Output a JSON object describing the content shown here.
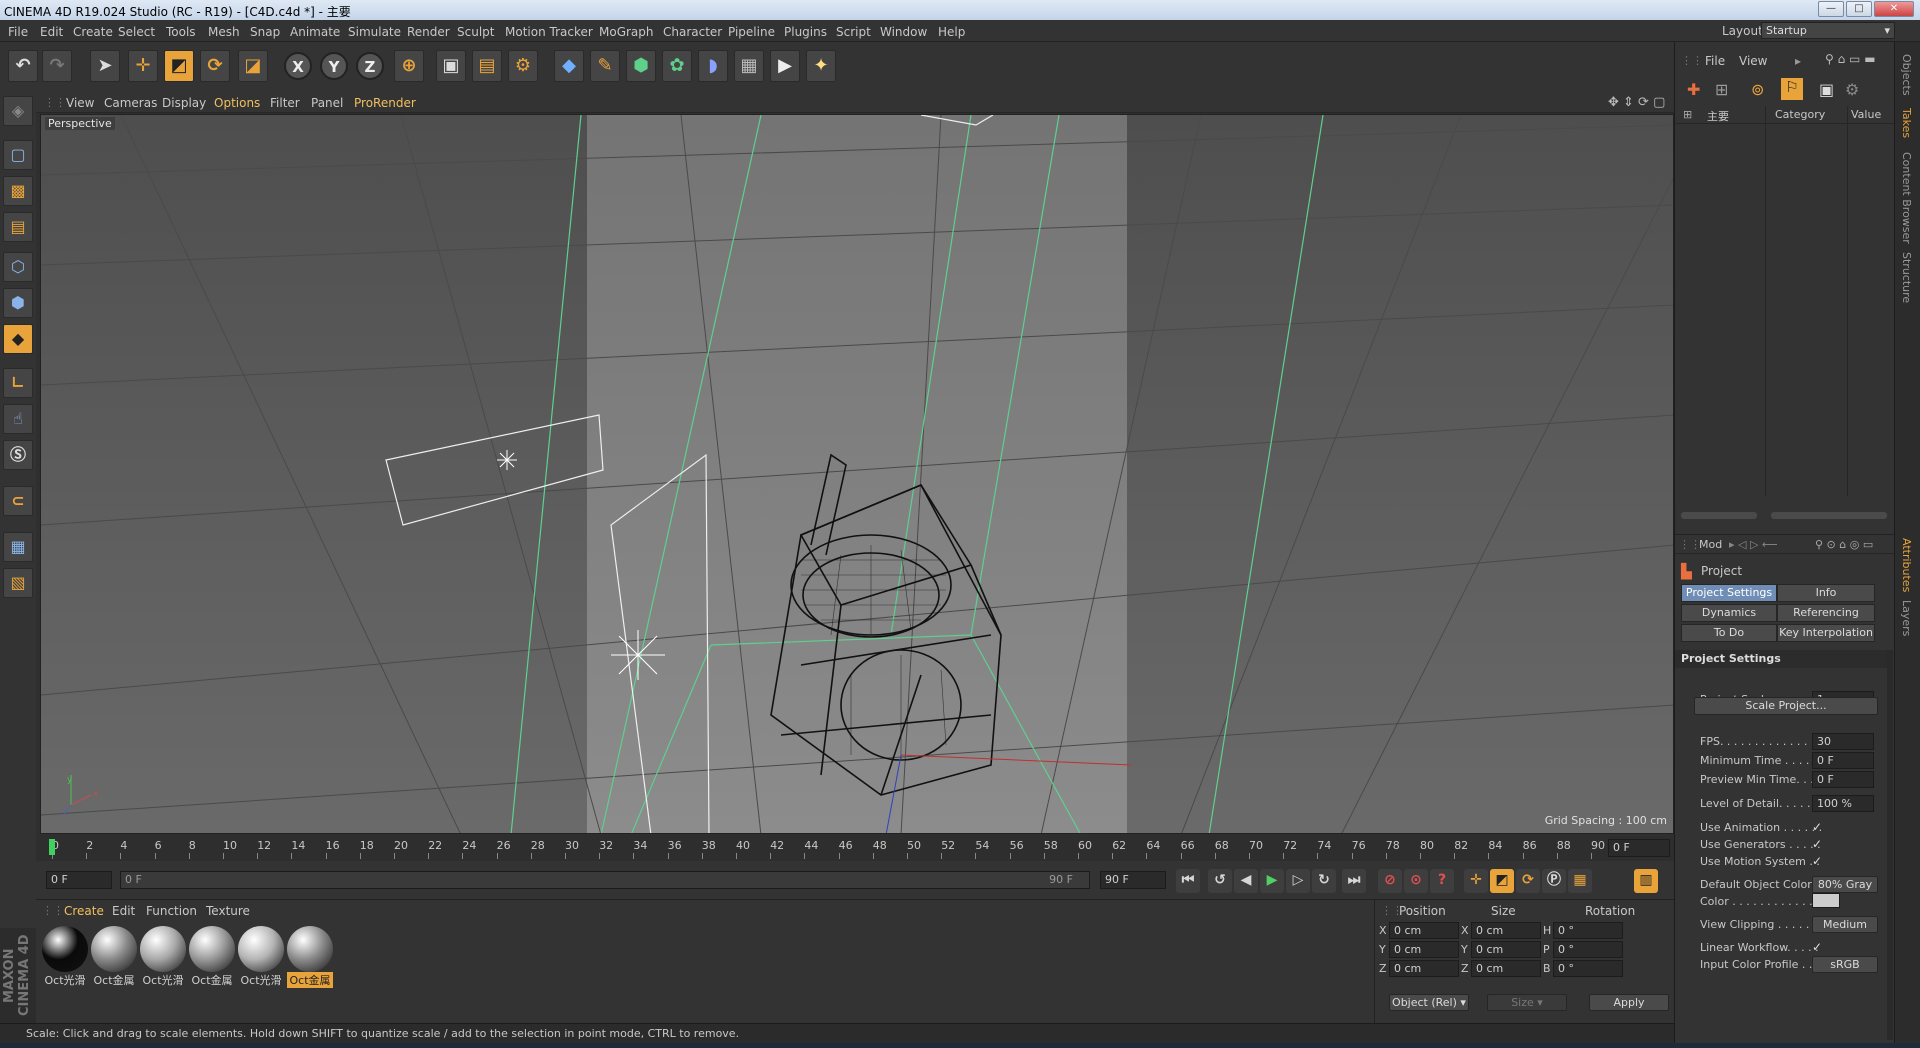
{
  "window": {
    "title": "CINEMA 4D R19.024 Studio (RC - R19) - [C4D.c4d *] - 主要",
    "min": "—",
    "max": "□",
    "close": "✕"
  },
  "menu": [
    "File",
    "Edit",
    "Create",
    "Select",
    "Tools",
    "Mesh",
    "Snap",
    "Animate",
    "Simulate",
    "Render",
    "Sculpt",
    "Motion Tracker",
    "MoGraph",
    "Character",
    "Pipeline",
    "Plugins",
    "Script",
    "Window",
    "Help"
  ],
  "layout": {
    "label": "Layout:",
    "value": "Startup"
  },
  "viewport_menu": [
    "View",
    "Cameras",
    "Display",
    "Options",
    "Filter",
    "Panel",
    "ProRender"
  ],
  "viewport": {
    "label": "Perspective",
    "grid_spacing": "Grid Spacing : 100 cm",
    "axis_y": "y",
    "axis_x": "x"
  },
  "timeline": {
    "ticks": [
      "0",
      "2",
      "4",
      "6",
      "8",
      "10",
      "12",
      "14",
      "16",
      "18",
      "20",
      "22",
      "24",
      "26",
      "28",
      "30",
      "32",
      "34",
      "36",
      "38",
      "40",
      "42",
      "44",
      "46",
      "48",
      "50",
      "52",
      "54",
      "56",
      "58",
      "60",
      "62",
      "64",
      "66",
      "68",
      "70",
      "72",
      "74",
      "76",
      "78",
      "80",
      "82",
      "84",
      "86",
      "88",
      "90"
    ],
    "end_field": "0 F",
    "current": "0 F",
    "range_start": "0 F",
    "range_end": "90 F",
    "max_field": "90 F"
  },
  "material_menu": [
    "Create",
    "Edit",
    "Function",
    "Texture"
  ],
  "materials": [
    {
      "name": "Oct光滑",
      "color": "#0a0a0a"
    },
    {
      "name": "Oct金属",
      "color": "#8a8a8a"
    },
    {
      "name": "Oct光滑",
      "color": "#a8a8a8"
    },
    {
      "name": "Oct金属",
      "color": "#9a9a9a"
    },
    {
      "name": "Oct光滑",
      "color": "#b4b4b4"
    },
    {
      "name": "Oct金属",
      "color": "#8c8c8c"
    }
  ],
  "coords": {
    "headers": [
      "Position",
      "Size",
      "Rotation"
    ],
    "rows": [
      {
        "pl": "X",
        "pv": "0 cm",
        "sl": "X",
        "sv": "0 cm",
        "rl": "H",
        "rv": "0 °"
      },
      {
        "pl": "Y",
        "pv": "0 cm",
        "sl": "Y",
        "sv": "0 cm",
        "rl": "P",
        "rv": "0 °"
      },
      {
        "pl": "Z",
        "pv": "0 cm",
        "sl": "Z",
        "sv": "0 cm",
        "rl": "B",
        "rv": "0 °"
      }
    ],
    "mode": "Object (Rel)",
    "size_mode": "Size",
    "apply": "Apply"
  },
  "status": "Scale: Click and drag to scale elements. Hold down SHIFT to quantize scale / add to the selection in point mode, CTRL to remove.",
  "objects_panel": {
    "menu": [
      "File",
      "View"
    ],
    "col_name": "主要",
    "col_category": "Category",
    "col_value": "Value"
  },
  "attributes": {
    "mode_label": "Mod",
    "title": "Project",
    "tabs": [
      "Project Settings",
      "Info",
      "Dynamics",
      "Referencing",
      "To Do",
      "Key Interpolation"
    ],
    "section": "Project Settings",
    "rows": [
      {
        "label": "Project Scale . . . . . . .",
        "value": "1",
        "type": "field"
      },
      {
        "label": "FPS. . . . . . . . . . . . . . . . .",
        "value": "30",
        "type": "field"
      },
      {
        "label": "Minimum Time . . . . .",
        "value": "0 F",
        "type": "field"
      },
      {
        "label": "Preview Min Time. . . .",
        "value": "0 F",
        "type": "field"
      },
      {
        "label": "Level of Detail. . . . . . .",
        "value": "100 %",
        "type": "field"
      },
      {
        "label": "Use Animation . . . . . .",
        "value": "✓",
        "type": "check"
      },
      {
        "label": "Use Generators . . . . .",
        "value": "✓",
        "type": "check"
      },
      {
        "label": "Use Motion System . .",
        "value": "✓",
        "type": "check"
      },
      {
        "label": "Default Object Color",
        "value": "80% Gray",
        "type": "btn"
      },
      {
        "label": "Color . . . . . . . . . . . . .",
        "value": "",
        "type": "swatch"
      },
      {
        "label": "View Clipping . . . . . . .",
        "value": "Medium",
        "type": "btn"
      },
      {
        "label": "Linear Workflow. . . . .",
        "value": "✓",
        "type": "check"
      },
      {
        "label": "Input Color Profile . . .",
        "value": "sRGB",
        "type": "btn"
      }
    ],
    "scale_button": "Scale Project..."
  },
  "side_tabs": [
    "Objects",
    "Takes",
    "Content Browser",
    "Structure",
    "Attributes",
    "Layers"
  ],
  "brand": "MAXON CINEMA 4D"
}
